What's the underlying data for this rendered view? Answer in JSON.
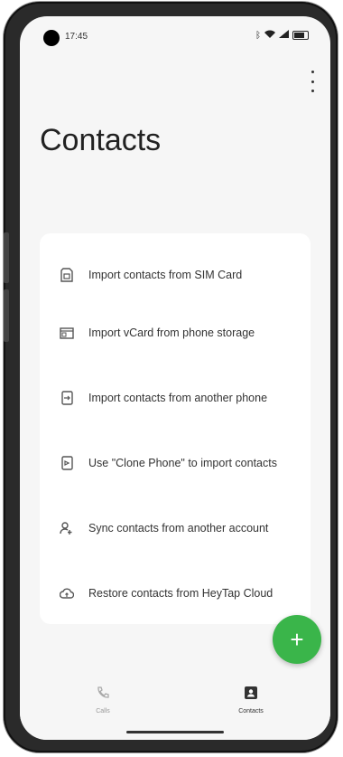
{
  "status_bar": {
    "time": "17:45",
    "icons": [
      "bluetooth-icon",
      "wifi-icon",
      "signal-icon",
      "battery-icon"
    ]
  },
  "page": {
    "title": "Contacts"
  },
  "import_options": [
    {
      "icon": "sim-card-icon",
      "label": "Import contacts from SIM Card"
    },
    {
      "icon": "vcard-icon",
      "label": "Import vCard from phone storage"
    },
    {
      "icon": "import-phone-icon",
      "label": "Import contacts from another phone"
    },
    {
      "icon": "clone-phone-icon",
      "label": "Use \"Clone Phone\" to import contacts"
    },
    {
      "icon": "sync-account-icon",
      "label": "Sync contacts from another account"
    },
    {
      "icon": "cloud-restore-icon",
      "label": "Restore contacts from HeyTap Cloud"
    }
  ],
  "fab": {
    "icon": "plus-icon",
    "label": "+"
  },
  "bottom_nav": {
    "tabs": [
      {
        "icon": "phone-icon",
        "label": "Calls",
        "active": false
      },
      {
        "icon": "contacts-icon",
        "label": "Contacts",
        "active": true
      }
    ]
  },
  "colors": {
    "accent": "#3ab54a",
    "background": "#f6f6f6",
    "card": "#ffffff",
    "text": "#333333"
  }
}
